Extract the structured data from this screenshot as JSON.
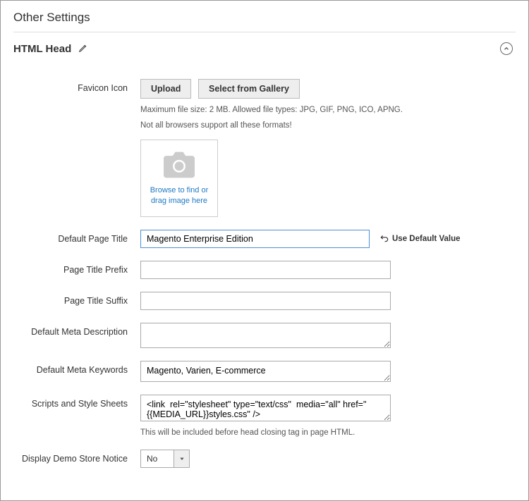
{
  "header": {
    "other_settings": "Other Settings",
    "section_title": "HTML Head"
  },
  "favicon": {
    "label": "Favicon Icon",
    "upload_btn": "Upload",
    "gallery_btn": "Select from Gallery",
    "hint1": "Maximum file size: 2 MB. Allowed file types: JPG, GIF, PNG, ICO, APNG.",
    "hint2": "Not all browsers support all these formats!",
    "browse_text": "Browse to find or drag image here"
  },
  "page_title": {
    "label": "Default Page Title",
    "value": "Magento Enterprise Edition",
    "reset": "Use Default Value"
  },
  "prefix": {
    "label": "Page Title Prefix",
    "value": ""
  },
  "suffix": {
    "label": "Page Title Suffix",
    "value": ""
  },
  "meta_desc": {
    "label": "Default Meta Description",
    "value": ""
  },
  "meta_keywords": {
    "label": "Default Meta Keywords",
    "value": "Magento, Varien, E-commerce"
  },
  "scripts": {
    "label": "Scripts and Style Sheets",
    "value": "<link  rel=\"stylesheet\" type=\"text/css\"  media=\"all\" href=\"{{MEDIA_URL}}styles.css\" />",
    "hint": "This will be included before head closing tag in page HTML."
  },
  "demo_notice": {
    "label": "Display Demo Store Notice",
    "selected": "No"
  }
}
